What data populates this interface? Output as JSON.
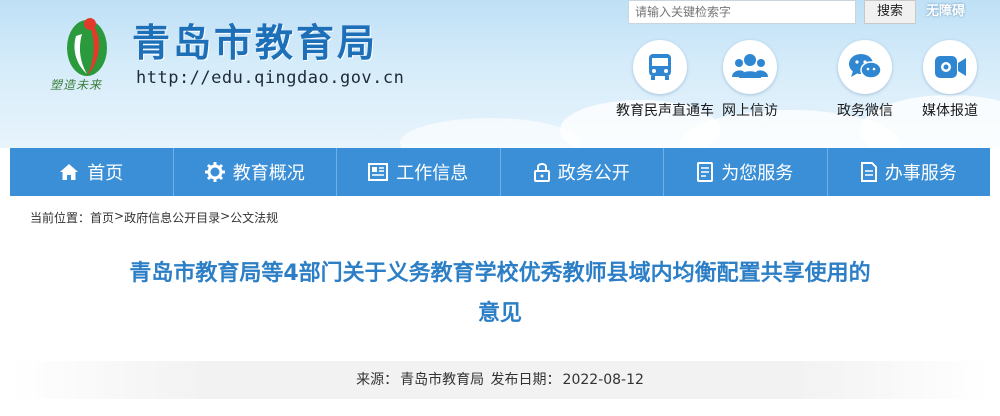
{
  "header": {
    "site_title": "青岛市教育局",
    "site_url": "http://edu.qingdao.gov.cn",
    "logo_motto": "塑造未来",
    "search": {
      "placeholder": "请输入关键检索字",
      "button": "搜索"
    },
    "accessibility": "无障碍",
    "quick_links": [
      {
        "label": "教育民声直通车",
        "icon": "bus-icon"
      },
      {
        "label": "网上信访",
        "icon": "users-icon"
      },
      {
        "label": "政务微信",
        "icon": "wechat-icon"
      },
      {
        "label": "媒体报道",
        "icon": "video-icon"
      }
    ]
  },
  "nav": [
    {
      "label": "首页",
      "icon": "home-icon"
    },
    {
      "label": "教育概况",
      "icon": "gear-icon"
    },
    {
      "label": "工作信息",
      "icon": "newspaper-icon"
    },
    {
      "label": "政务公开",
      "icon": "lock-icon"
    },
    {
      "label": "为您服务",
      "icon": "document-icon"
    },
    {
      "label": "办事服务",
      "icon": "file-icon"
    }
  ],
  "breadcrumb": {
    "prefix": "当前位置：",
    "items": [
      "首页",
      "政府信息公开目录",
      "公文法规"
    ],
    "separator": ">"
  },
  "article": {
    "title_line1": "青岛市教育局等4部门关于义务教育学校优秀教师县域内均衡配置共享使用的",
    "title_line2": "意见",
    "source_label": "来源：",
    "source": "青岛市教育局",
    "date_label": "发布日期：",
    "date": "2022-08-12"
  },
  "colors": {
    "brand_blue": "#2c7fc6",
    "nav_blue": "#3a8fd6",
    "title_blue": "#1d6fb8"
  }
}
